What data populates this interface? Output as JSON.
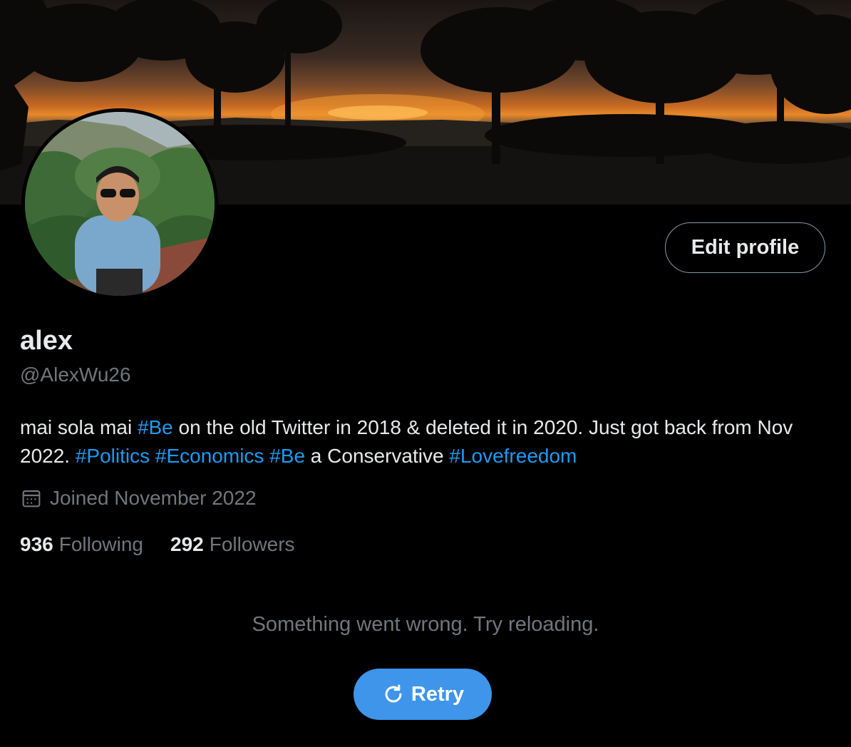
{
  "profile": {
    "display_name": "alex",
    "handle": "@AlexWu26",
    "edit_profile_label": "Edit profile",
    "bio": [
      {
        "text": "mai sola mai ",
        "tag": false
      },
      {
        "text": "#Be",
        "tag": true
      },
      {
        "text": " on the old Twitter in 2018 & deleted it in 2020. Just got back from Nov 2022. ",
        "tag": false
      },
      {
        "text": "#Politics",
        "tag": true
      },
      {
        "text": " ",
        "tag": false
      },
      {
        "text": "#Economics",
        "tag": true
      },
      {
        "text": " ",
        "tag": false
      },
      {
        "text": "#Be",
        "tag": true
      },
      {
        "text": " a Conservative ",
        "tag": false
      },
      {
        "text": "#Lovefreedom",
        "tag": true
      }
    ],
    "joined": "Joined November 2022",
    "joined_icon": "calendar-icon",
    "following_count": "936",
    "following_label": "Following",
    "followers_count": "292",
    "followers_label": "Followers"
  },
  "timeline": {
    "error_message": "Something went wrong. Try reloading.",
    "retry_label": "Retry",
    "retry_icon": "refresh-icon"
  },
  "colors": {
    "background": "#000000",
    "text": "#e7e9ea",
    "muted": "#71767b",
    "link": "#1d9bf0",
    "button": "#3e95ea"
  }
}
